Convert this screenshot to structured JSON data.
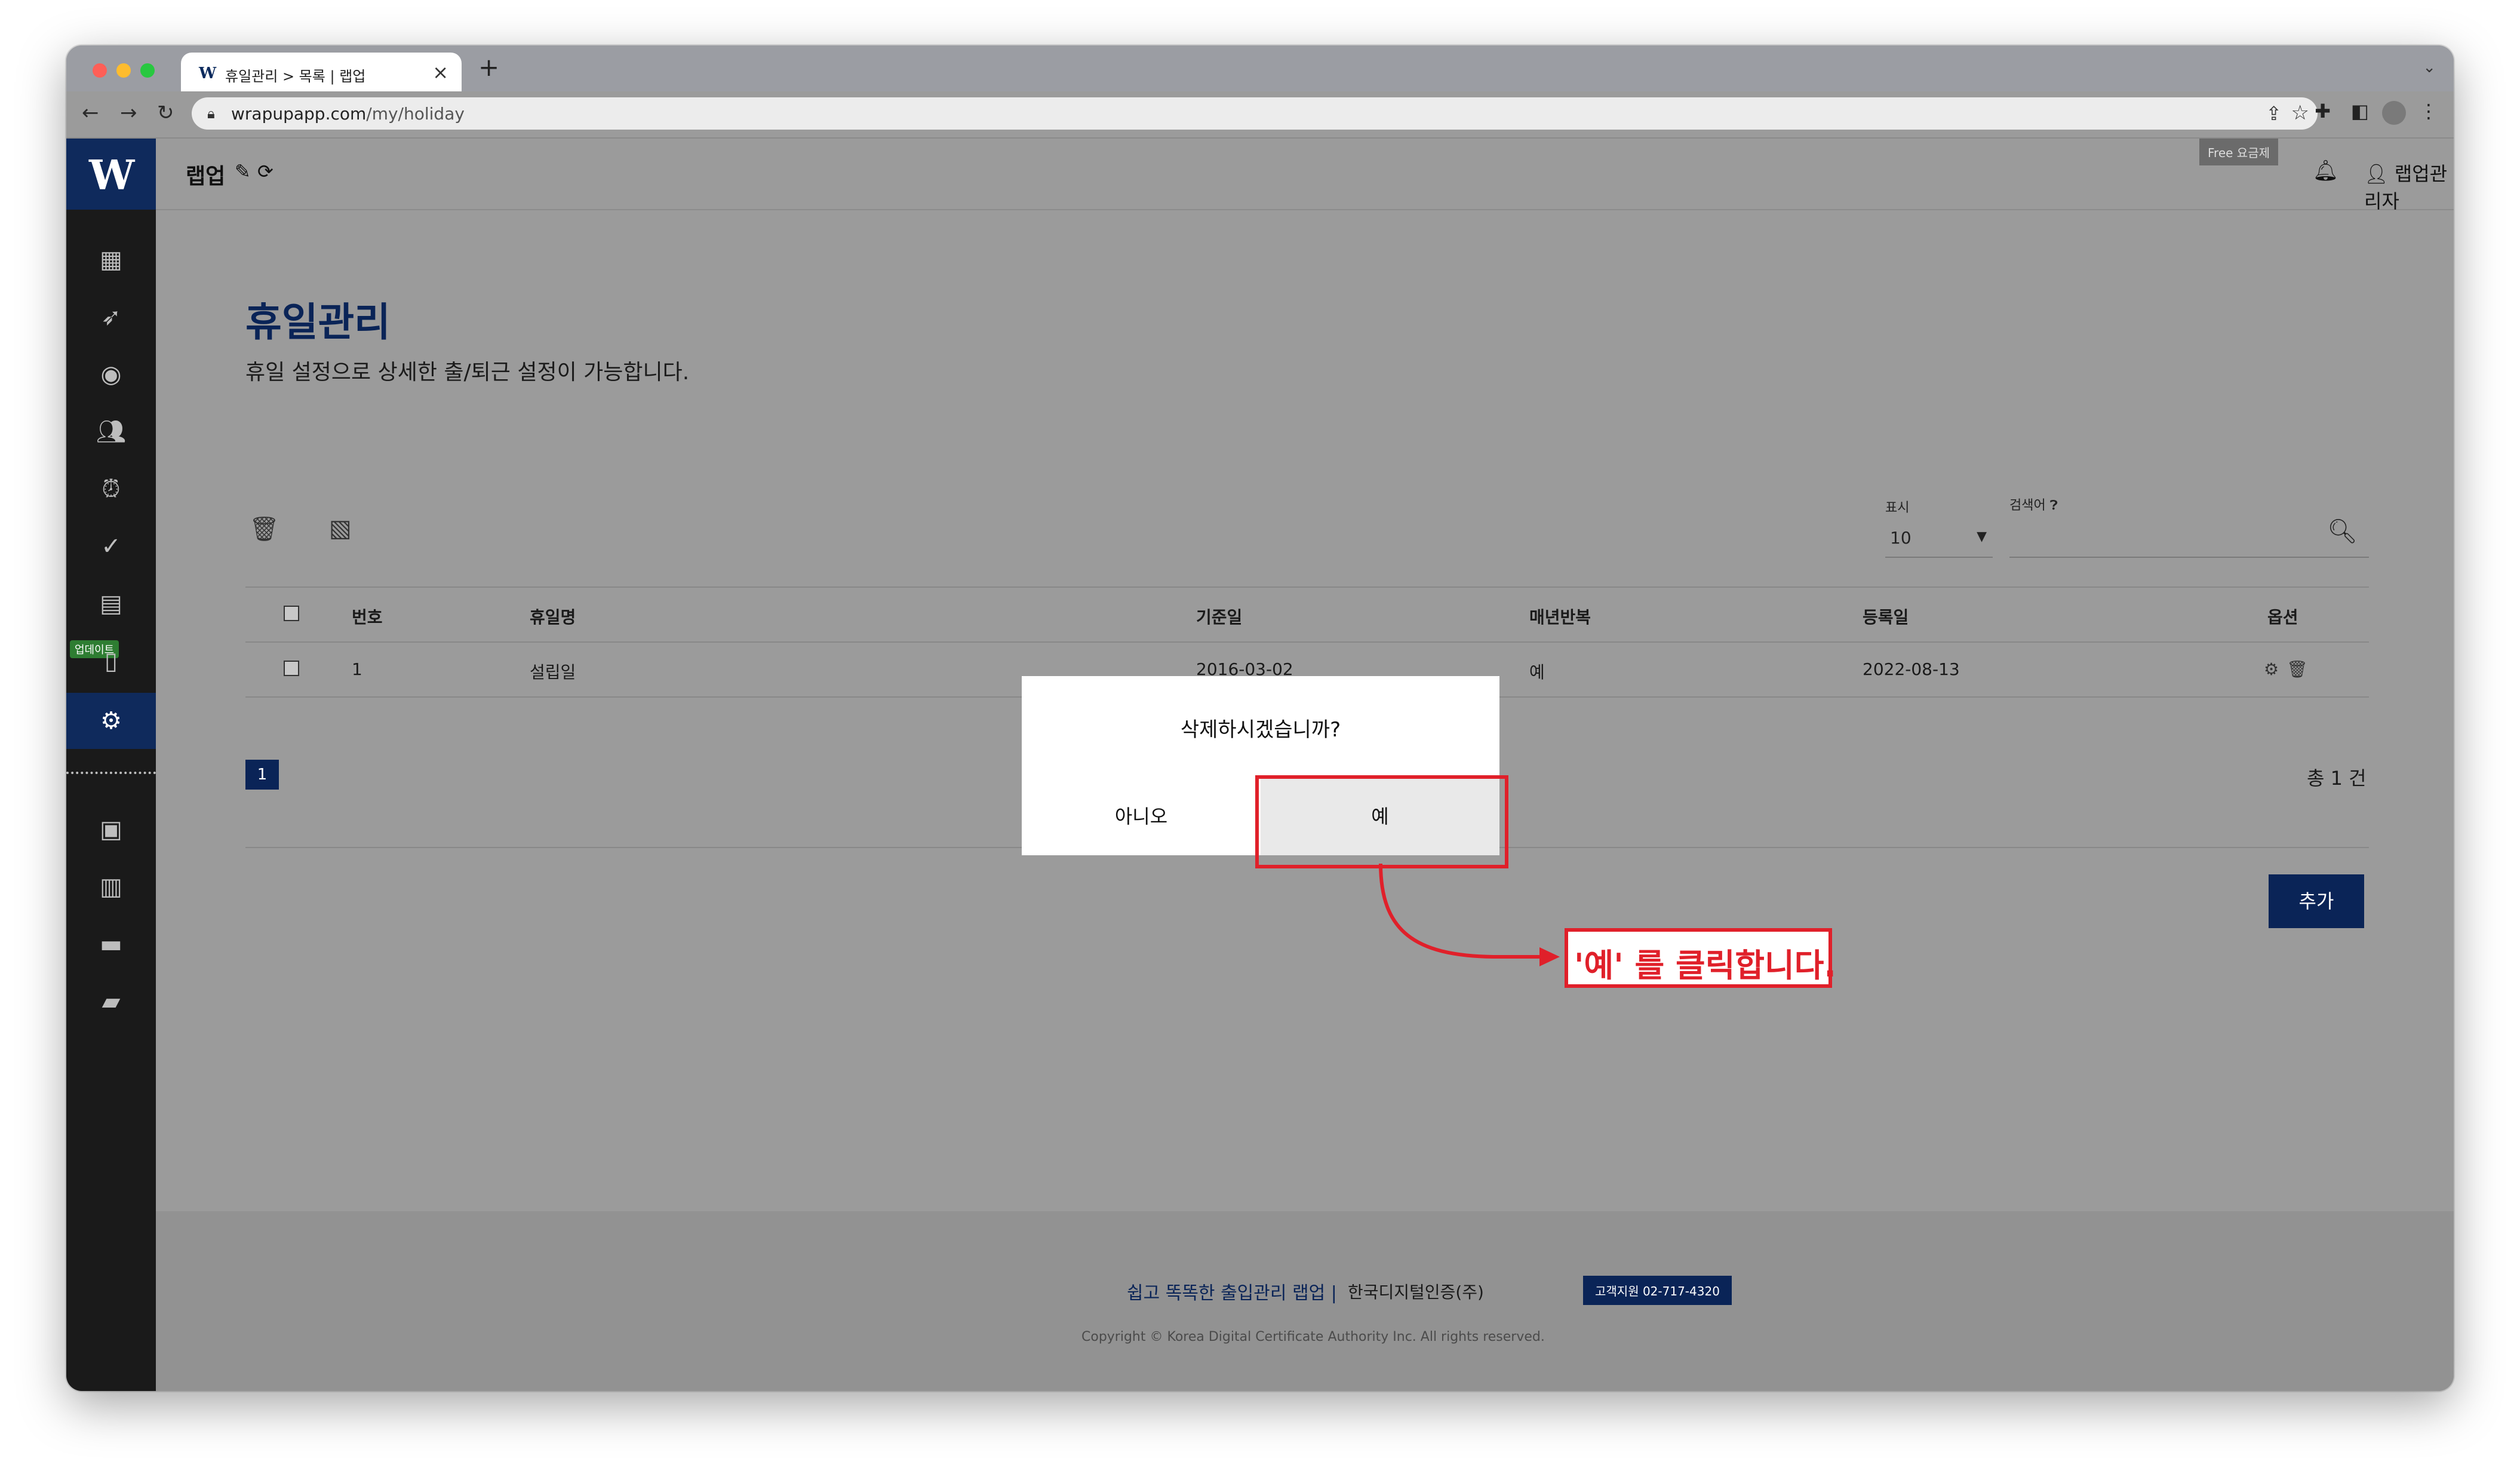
{
  "browser": {
    "tab_title": "휴일관리 > 목록 | 랩업",
    "favicon": "W",
    "url_host": "wrapupapp.com",
    "url_path": "/my/holiday"
  },
  "app": {
    "logo": "W",
    "brand": "랩업",
    "plan_badge": "Free 요금제",
    "user_name": "랩업관리자",
    "sidebar_badge": "업데이트"
  },
  "page": {
    "title": "휴일관리",
    "subtitle": "휴일 설정으로 상세한 출/퇴근 설정이 가능합니다."
  },
  "filters": {
    "display_label": "표시",
    "display_value": "10",
    "search_label": "검색어"
  },
  "table": {
    "headers": [
      "번호",
      "휴일명",
      "기준일",
      "매년반복",
      "등록일",
      "옵션"
    ],
    "rows": [
      {
        "no": "1",
        "name": "설립일",
        "base_date": "2016-03-02",
        "repeat": "예",
        "registered": "2022-08-13"
      }
    ]
  },
  "pagination": {
    "current": "1",
    "total": "총 1 건"
  },
  "add_label": "추가",
  "dialog": {
    "message": "삭제하시겠습니까?",
    "no_label": "아니오",
    "yes_label": "예"
  },
  "annotation": {
    "callout": "'예' 를 클릭합니다."
  },
  "footer": {
    "main": "쉽고 똑똑한 출입관리 랩업 |",
    "company": "한국디지털인증(주)",
    "support": "고객지원 02-717-4320",
    "copyright": "Copyright © Korea Digital Certificate Authority Inc. All rights reserved."
  },
  "colors": {
    "brand_navy": "#0a2457",
    "sidebar": "#1a1a1a",
    "highlight": "#e0202a"
  }
}
